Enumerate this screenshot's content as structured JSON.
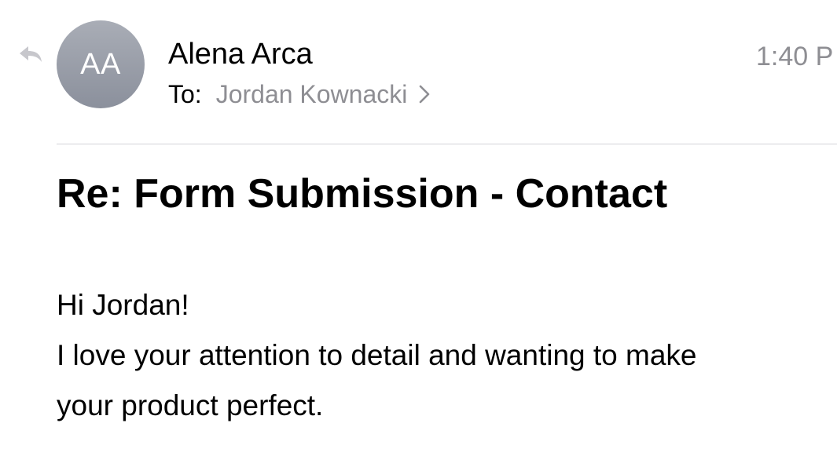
{
  "message": {
    "sender": {
      "name": "Alena Arca",
      "initials": "AA"
    },
    "recipient": {
      "label": "To:",
      "name": "Jordan Kownacki"
    },
    "time": "1:40 P",
    "subject": "Re: Form Submission - Contact",
    "body": {
      "greeting": "Hi Jordan!",
      "line_1": "I love your attention to detail and wanting to make",
      "line_2": "your product perfect."
    }
  },
  "icons": {
    "reply_indicator": "reply-arrow-icon",
    "recipient_disclosure": "chevron-right-icon"
  },
  "colors": {
    "avatar": "#9a9ea8",
    "secondary_text": "#8e8e93",
    "divider": "#d4d4d8"
  }
}
